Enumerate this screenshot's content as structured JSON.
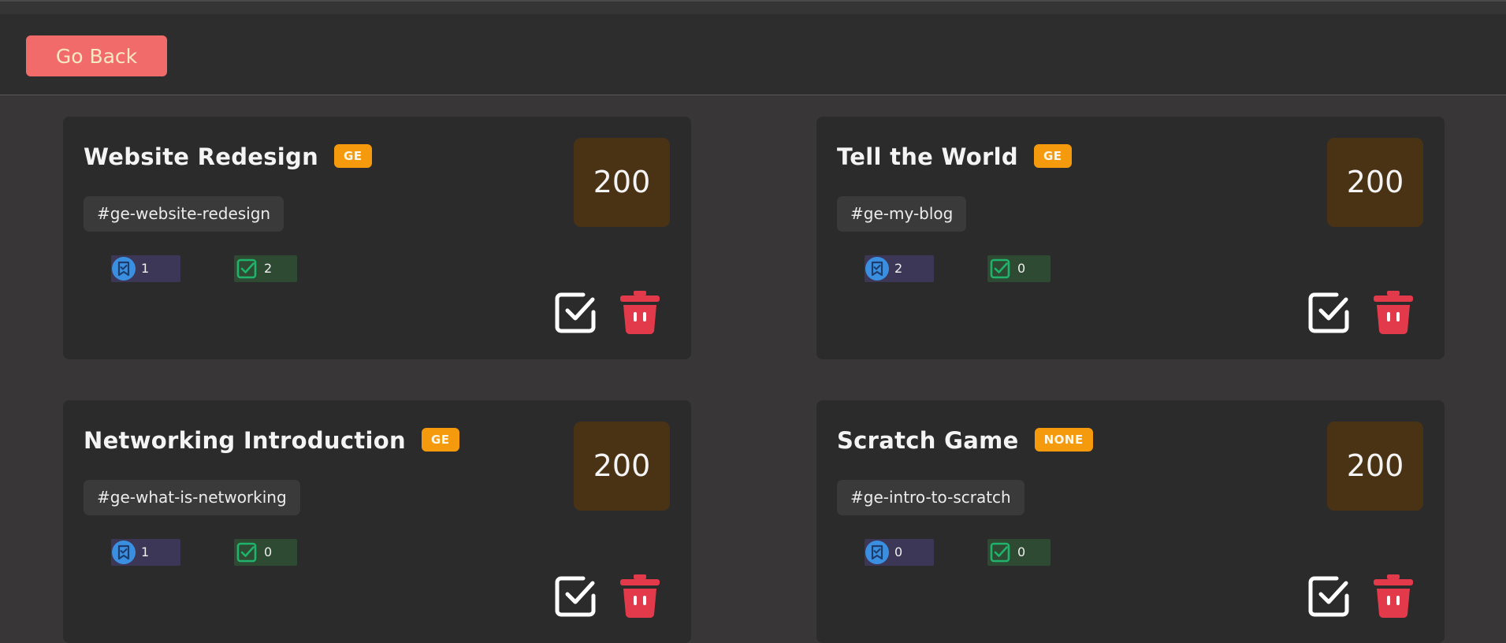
{
  "header": {
    "back_label": "Go Back"
  },
  "colors": {
    "background": "#383637",
    "card": "#2b2b2b",
    "back_button": "#f26b6b",
    "badge": "#f59a0c",
    "score_box": "#4a3214",
    "delete_icon": "#e23a4a",
    "bookmark_stat": "#3d3757",
    "done_stat": "#2e4a32"
  },
  "cards": [
    {
      "title": "Website Redesign",
      "badge": "GE",
      "tag": "#ge-website-redesign",
      "score": "200",
      "bookmarks": "1",
      "completed": "2"
    },
    {
      "title": "Tell the World",
      "badge": "GE",
      "tag": "#ge-my-blog",
      "score": "200",
      "bookmarks": "2",
      "completed": "0"
    },
    {
      "title": "Networking Introduction",
      "badge": "GE",
      "tag": "#ge-what-is-networking",
      "score": "200",
      "bookmarks": "1",
      "completed": "0"
    },
    {
      "title": "Scratch Game",
      "badge": "NONE",
      "tag": "#ge-intro-to-scratch",
      "score": "200",
      "bookmarks": "0",
      "completed": "0"
    }
  ],
  "icons": {
    "bookmark": "bookmark-icon",
    "check_square": "check-square-icon",
    "complete": "checkbox-icon",
    "delete": "trash-icon"
  }
}
